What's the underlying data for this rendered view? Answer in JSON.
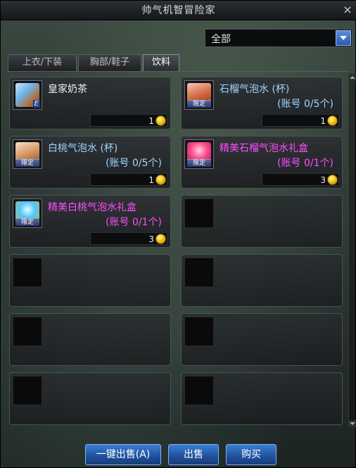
{
  "window": {
    "title": "帅气机智冒险家",
    "close_label": "×"
  },
  "filter": {
    "selected": "全部"
  },
  "tabs": [
    {
      "label": "上衣/下装",
      "active": false
    },
    {
      "label": "胸部/鞋子",
      "active": false
    },
    {
      "label": "饮料",
      "active": true
    }
  ],
  "items": [
    {
      "name": "皇家奶茶",
      "limit": "",
      "price": "1",
      "badge": "E",
      "name_color": "white"
    },
    {
      "name": "石榴气泡水 (杯)",
      "limit": "(账号 0/5个)",
      "price": "1",
      "badge": "限定",
      "name_color": "blue"
    },
    {
      "name": "白桃气泡水 (杯)",
      "limit": "(账号 0/5个)",
      "price": "1",
      "badge": "限定",
      "name_color": "blue"
    },
    {
      "name": "精美石榴气泡水礼盒",
      "limit": "(账号 0/1个)",
      "price": "3",
      "badge": "限定",
      "name_color": "magenta"
    },
    {
      "name": "精美白桃气泡水礼盒",
      "limit": "(账号 0/1个)",
      "price": "3",
      "badge": "限定",
      "name_color": "magenta"
    }
  ],
  "empty_slots": 7,
  "buttons": {
    "quick_sell": "一键出售(A)",
    "sell": "出售",
    "buy": "购买"
  },
  "colors": {
    "accent_button": "#2b62b8",
    "name_blue": "#9fd5ff",
    "name_magenta": "#ff4cff",
    "coin_gold": "#f2c21a"
  }
}
